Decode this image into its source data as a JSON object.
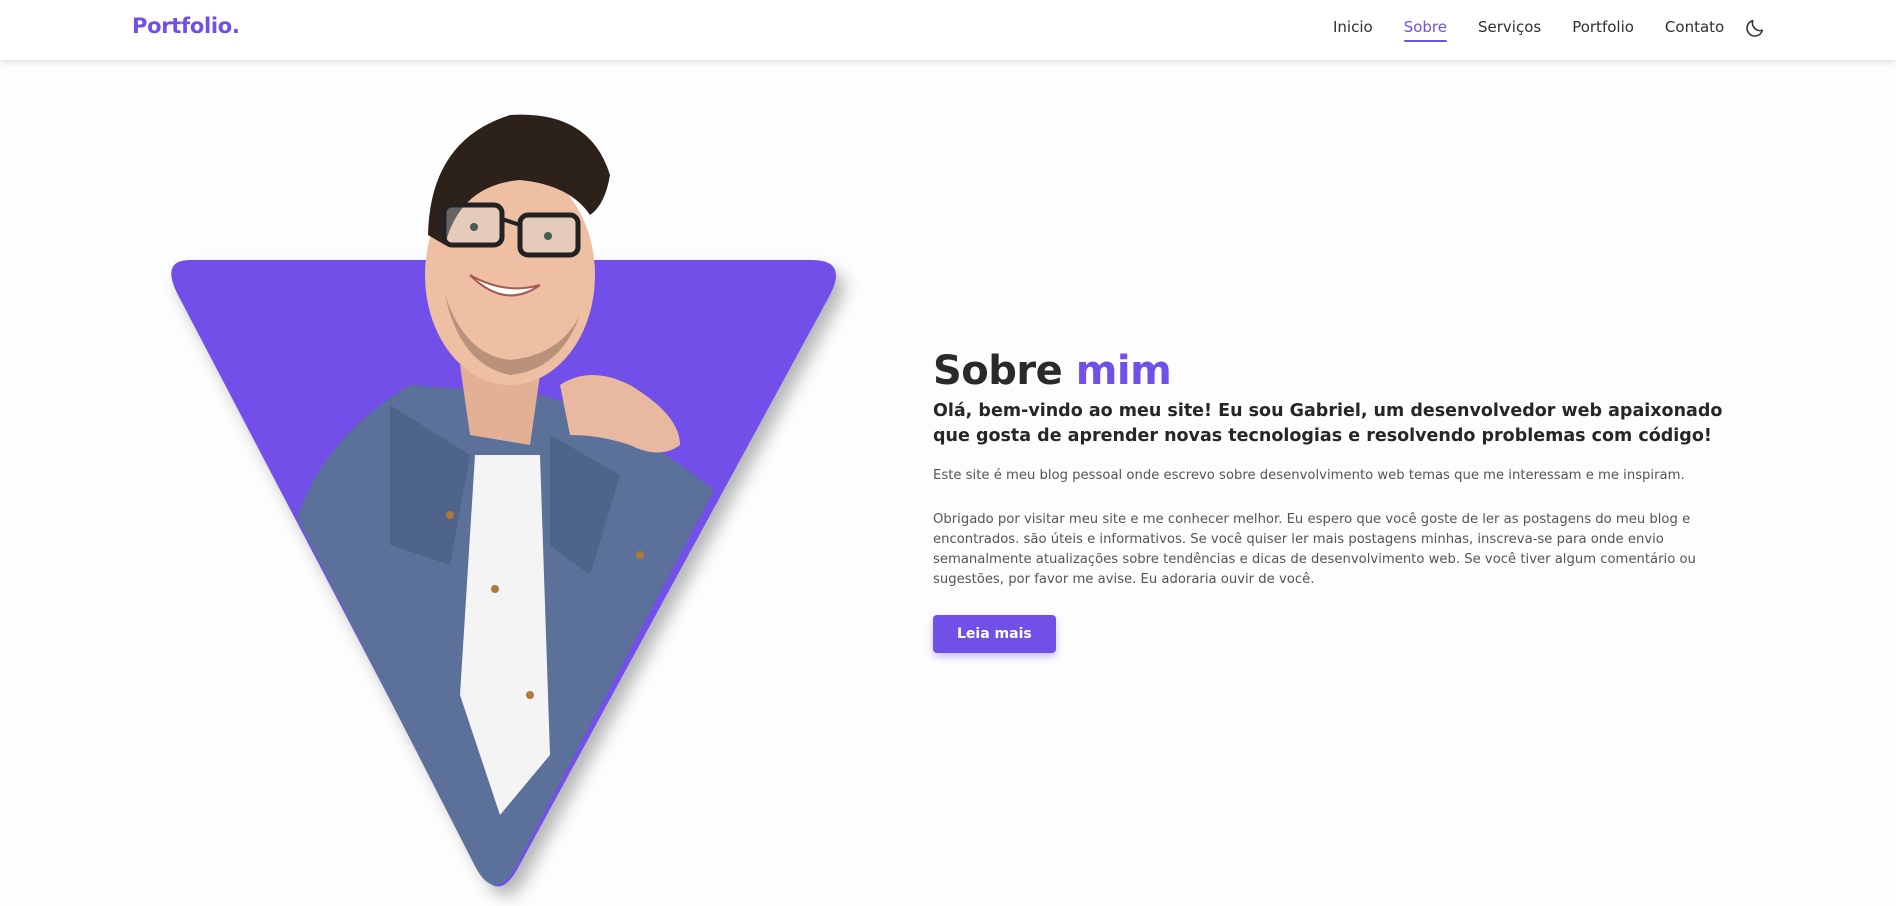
{
  "header": {
    "logo": "Portfolio.",
    "nav": [
      {
        "label": "Inicio",
        "active": false
      },
      {
        "label": "Sobre",
        "active": true
      },
      {
        "label": "Serviços",
        "active": false
      },
      {
        "label": "Portfolio",
        "active": false
      },
      {
        "label": "Contato",
        "active": false
      }
    ],
    "theme_icon": "moon-icon"
  },
  "hero": {
    "image": "portrait-photo",
    "accent_color": "#7150e8"
  },
  "about": {
    "title_main": "Sobre",
    "title_accent": "mim",
    "lead": "Olá, bem-vindo ao meu site! Eu sou Gabriel, um desenvolvedor web apaixonado que gosta de aprender novas tecnologias e resolvendo problemas com código!",
    "paragraph1": "Este site é meu blog pessoal onde escrevo sobre desenvolvimento web temas que me interessam e me inspiram.",
    "paragraph2": "Obrigado por visitar meu site e me conhecer melhor. Eu espero que você goste de ler as postagens do meu blog e encontrados. são úteis e informativos. Se você quiser ler mais postagens minhas, inscreva-se para onde envio semanalmente atualizações sobre tendências e dicas de desenvolvimento web. Se você tiver algum comentário ou sugestões, por favor me avise. Eu adoraria ouvir de você.",
    "button_label": "Leia mais"
  },
  "colors": {
    "accent": "#7150e8",
    "text": "#2a2a2a",
    "background": "#fdfdfd"
  }
}
